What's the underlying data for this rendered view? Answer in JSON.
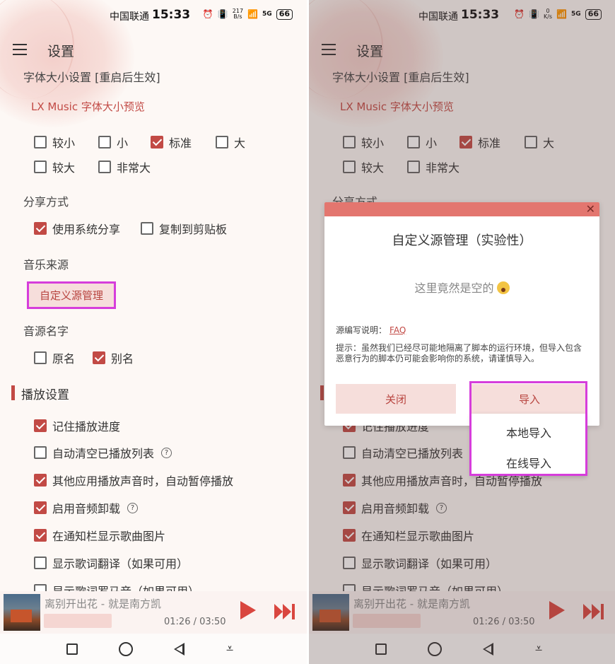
{
  "status": {
    "carrier": "中国联通",
    "time": "15:33",
    "left_net_speed_value": "217",
    "left_net_speed_unit": "B/s",
    "right_net_speed_value": "0",
    "right_net_speed_unit": "K/s",
    "signal": "5G",
    "battery": "66"
  },
  "header": {
    "title": "设置"
  },
  "font_size": {
    "label": "字体大小设置 [重启后生效]",
    "preview": "LX Music 字体大小预览",
    "options": [
      {
        "label": "较小",
        "checked": false
      },
      {
        "label": "小",
        "checked": false
      },
      {
        "label": "标准",
        "checked": true
      },
      {
        "label": "大",
        "checked": false
      },
      {
        "label": "较大",
        "checked": false
      },
      {
        "label": "非常大",
        "checked": false
      }
    ]
  },
  "share": {
    "label": "分享方式",
    "options": [
      {
        "label": "使用系统分享",
        "checked": true
      },
      {
        "label": "复制到剪贴板",
        "checked": false
      }
    ]
  },
  "music_source": {
    "label": "音乐来源",
    "custom_button": "自定义源管理"
  },
  "source_name": {
    "label": "音源名字",
    "options": [
      {
        "label": "原名",
        "checked": false
      },
      {
        "label": "别名",
        "checked": true
      }
    ]
  },
  "playback": {
    "heading": "播放设置",
    "options": [
      {
        "label": "记住播放进度",
        "checked": true
      },
      {
        "label": "自动清空已播放列表",
        "checked": false
      },
      {
        "label": "其他应用播放声音时，自动暂停播放",
        "checked": true
      },
      {
        "label": "启用音频卸载",
        "checked": true
      },
      {
        "label": "在通知栏显示歌曲图片",
        "checked": true
      },
      {
        "label": "显示歌词翻译（如果可用）",
        "checked": false
      },
      {
        "label": "显示歌词罗马音（如果可用）",
        "checked": false
      }
    ],
    "help_icon": "?"
  },
  "player": {
    "song": "离别开出花 - 就是南方凯",
    "time": "01:26 / 03:50"
  },
  "dialog": {
    "close_symbol": "✕",
    "title": "自定义源管理（实验性）",
    "empty": "这里竟然是空的",
    "faq_label": "源编写说明：",
    "faq_link": "FAQ",
    "tip": "提示：虽然我们已经尽可能地隔离了脚本的运行环境，但导入包含恶意行为的脚本仍可能会影响你的系统，请谨慎导入。",
    "close_button": "关闭",
    "import_button": "导入"
  },
  "import_menu": {
    "local": "本地导入",
    "online": "在线导入"
  },
  "colors": {
    "accent": "#c24a45",
    "highlight": "#d63ddb",
    "button_bg": "#f6dedb"
  }
}
